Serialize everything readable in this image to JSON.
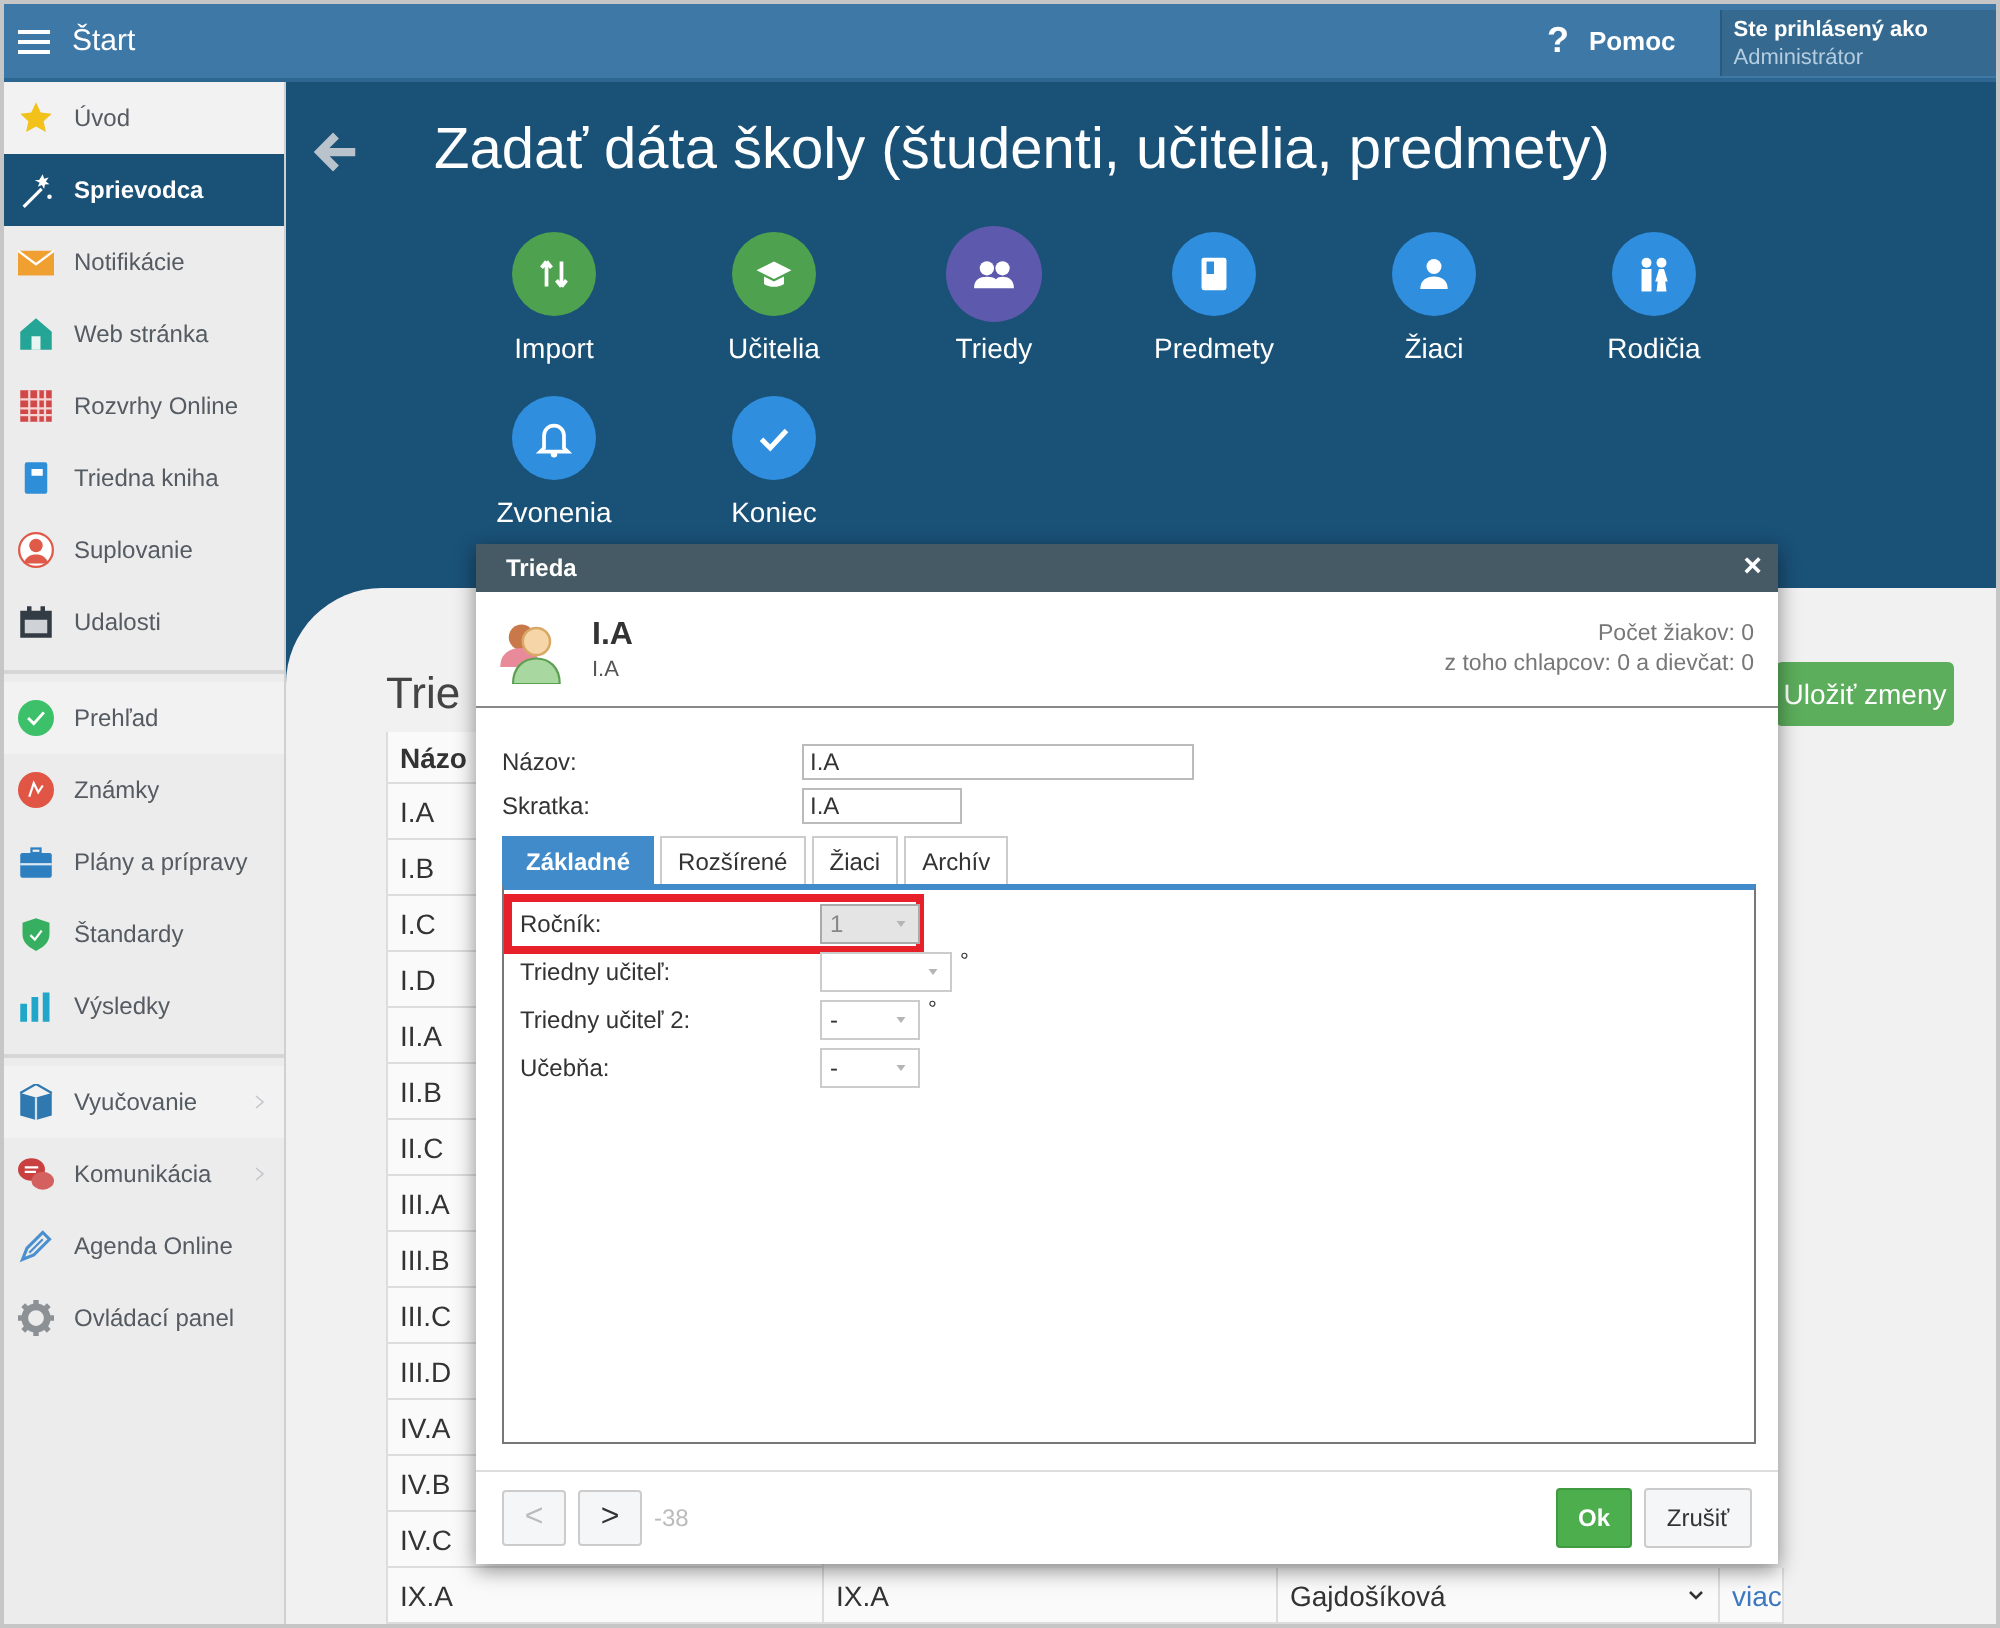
{
  "topbar": {
    "title": "Štart",
    "help_icon": "?",
    "help": "Pomoc",
    "user_caption": "Ste prihlásený ako",
    "user_name": "Administrátor"
  },
  "sidebar": {
    "groups": [
      [
        {
          "label": "Úvod",
          "selected": false
        },
        {
          "label": "Sprievodca",
          "selected": true
        },
        {
          "label": "Notifikácie",
          "selected": false
        },
        {
          "label": "Web stránka",
          "selected": false
        },
        {
          "label": "Rozvrhy Online",
          "selected": false
        },
        {
          "label": "Triedna kniha",
          "selected": false
        },
        {
          "label": "Suplovanie",
          "selected": false
        },
        {
          "label": "Udalosti",
          "selected": false
        }
      ],
      [
        {
          "label": "Prehľad",
          "selected": false
        },
        {
          "label": "Známky",
          "selected": false
        },
        {
          "label": "Plány a prípravy",
          "selected": false
        },
        {
          "label": "Štandardy",
          "selected": false
        },
        {
          "label": "Výsledky",
          "selected": false
        }
      ],
      [
        {
          "label": "Vyučovanie",
          "selected": false,
          "has_submenu": true
        },
        {
          "label": "Komunikácia",
          "selected": false,
          "has_submenu": true
        },
        {
          "label": "Agenda Online",
          "selected": false,
          "has_submenu": false
        },
        {
          "label": "Ovládací panel",
          "selected": false,
          "has_submenu": false
        }
      ]
    ]
  },
  "header": {
    "title": "Zadať dáta školy (študenti, učitelia, predmety)"
  },
  "wizard_steps": [
    {
      "label": "Import",
      "color": "#4ea24f",
      "selected": false
    },
    {
      "label": "Učitelia",
      "color": "#4ea24f",
      "selected": false
    },
    {
      "label": "Triedy",
      "color": "#5d5aae",
      "selected": true
    },
    {
      "label": "Predmety",
      "color": "#2f8fde",
      "selected": false
    },
    {
      "label": "Žiaci",
      "color": "#2f8fde",
      "selected": false
    },
    {
      "label": "Rodičia",
      "color": "#2f8fde",
      "selected": false
    },
    {
      "label": "Zvonenia",
      "color": "#2f8fde",
      "selected": false
    },
    {
      "label": "Koniec",
      "color": "#2f8fde",
      "selected": false
    }
  ],
  "content": {
    "title": "Trie",
    "save_button": "Uložiť zmeny",
    "table": {
      "columns": [
        "Názo"
      ],
      "rows": [
        {
          "cells": [
            "I.A"
          ]
        },
        {
          "cells": [
            "I.B"
          ]
        },
        {
          "cells": [
            "I.C"
          ]
        },
        {
          "cells": [
            "I.D"
          ]
        },
        {
          "cells": [
            "II.A"
          ]
        },
        {
          "cells": [
            "II.B"
          ]
        },
        {
          "cells": [
            "II.C"
          ]
        },
        {
          "cells": [
            "III.A"
          ]
        },
        {
          "cells": [
            "III.B"
          ]
        },
        {
          "cells": [
            "III.C"
          ]
        },
        {
          "cells": [
            "III.D"
          ]
        },
        {
          "cells": [
            "IV.A"
          ]
        },
        {
          "cells": [
            "IV.B"
          ]
        },
        {
          "cells": [
            "IV.C"
          ]
        },
        {
          "cells": [
            "IX.A",
            "IX.A",
            "Gajdošíková",
            "viac"
          ]
        }
      ]
    }
  },
  "dialog": {
    "title": "Trieda",
    "close": "×",
    "name": "I.A",
    "short": "I.A",
    "stats": [
      "Počet žiakov: 0",
      "z toho chlapcov: 0 a dievčat: 0"
    ],
    "inputs": [
      {
        "label": "Názov:",
        "value": "I.A"
      },
      {
        "label": "Skratka:",
        "value": "I.A"
      }
    ],
    "tabs": [
      {
        "label": "Základné",
        "selected": true
      },
      {
        "label": "Rozšírené",
        "selected": false
      },
      {
        "label": "Žiaci",
        "selected": false
      },
      {
        "label": "Archív",
        "selected": false
      }
    ],
    "fields": [
      {
        "label": "Ročník:",
        "value": "1",
        "disabled": true,
        "highlighted": true
      },
      {
        "label": "Triedny učiteľ:",
        "note": "°",
        "disabled": false,
        "highlighted": false
      },
      {
        "label": "Triedny učiteľ 2:",
        "value": "-",
        "note": "°",
        "disabled": false,
        "highlighted": false
      },
      {
        "label": "Učebňa:",
        "value": "-",
        "disabled": false,
        "highlighted": false
      }
    ],
    "footer": {
      "prev": "<",
      "prev_disabled": true,
      "next": ">",
      "counter": "-38",
      "ok": "Ok",
      "cancel": "Zrušiť"
    }
  }
}
